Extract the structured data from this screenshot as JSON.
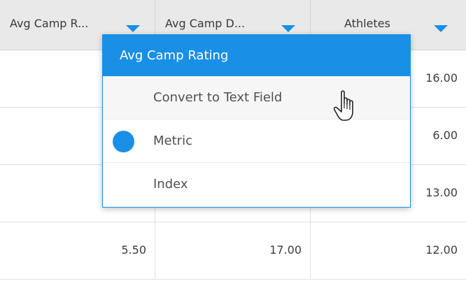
{
  "columns": [
    {
      "label": "Avg Camp R..."
    },
    {
      "label": "Avg Camp D..."
    },
    {
      "label": "Athletes"
    }
  ],
  "rows": [
    {
      "col3": "16.00"
    },
    {
      "col3": "6.00"
    },
    {
      "col3": "13.00"
    },
    {
      "col1": "5.50",
      "col2": "17.00",
      "col3": "12.00"
    }
  ],
  "menu": {
    "title": "Avg Camp Rating",
    "items": [
      {
        "label": "Convert to Text Field"
      },
      {
        "label": "Metric",
        "selected": true
      },
      {
        "label": "Index"
      }
    ]
  },
  "colors": {
    "accent": "#1a8fe6",
    "header_bg": "#e9e9e9"
  },
  "icons": {
    "column_menu": "triangle-down-icon",
    "cursor": "hand-pointer-icon",
    "selected": "filled-circle-icon"
  }
}
